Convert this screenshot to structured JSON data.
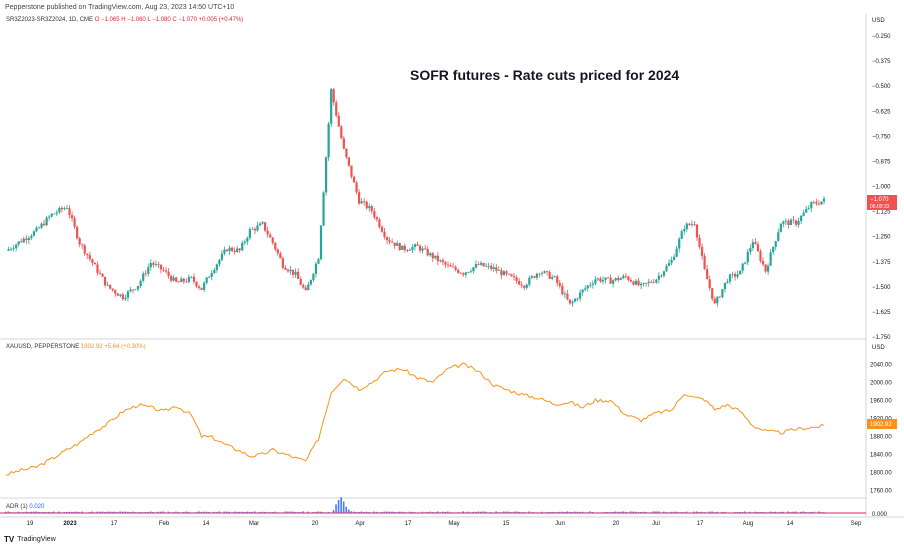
{
  "publisher_line": "Pepperstone published on TradingView.com, Aug 23, 2023 14:50 UTC+10",
  "title": "SOFR futures - Rate cuts priced for 2024",
  "footer_brand": "TradingView",
  "colors": {
    "up": "#26a69a",
    "down": "#ef5350",
    "gold": "#f7931a",
    "adr_up": "#2962ff",
    "adr_down": "#e91e63"
  },
  "panes": {
    "spread": {
      "legend_symbol": "SR3Z2023-SR3Z2024, 1D, CME",
      "legend_values": "O −1.065  H −1.060  L −1.080  C −1.070  +0.005 (+0.47%)",
      "currency": "USD",
      "last_price": "−1.070",
      "countdown": "06:09:33"
    },
    "gold": {
      "legend_symbol": "XAUUSD, PEPPERSTONE",
      "legend_values": "1902.92  +5.64 (+0.30%)",
      "currency": "USD",
      "last_price": "1902.92"
    },
    "adr": {
      "legend_symbol": "ADR (1)",
      "legend_values": "0.020",
      "last_price": "0.000"
    }
  },
  "x_axis_labels": [
    "19",
    "2023",
    "17",
    "Feb",
    "14",
    "Mar",
    "20",
    "Apr",
    "17",
    "May",
    "15",
    "Jun",
    "20",
    "Jul",
    "17",
    "Aug",
    "14",
    "Sep"
  ],
  "chart_data": [
    {
      "type": "candlestick",
      "name": "SR3Z2023-SR3Z2024",
      "y_ticks": [
        "−0.250",
        "−0.375",
        "−0.500",
        "−0.625",
        "−0.750",
        "−0.875",
        "−1.000",
        "−1.125",
        "−1.250",
        "−1.375",
        "−1.500",
        "−1.625",
        "−1.750"
      ],
      "ylim": [
        -1.75,
        -0.25
      ],
      "close_path": [
        [
          0,
          -1.32
        ],
        [
          6,
          -1.27
        ],
        [
          12,
          -1.22
        ],
        [
          18,
          -1.14
        ],
        [
          24,
          -1.1
        ],
        [
          29,
          -1.28
        ],
        [
          34,
          -1.38
        ],
        [
          40,
          -1.5
        ],
        [
          46,
          -1.55
        ],
        [
          52,
          -1.49
        ],
        [
          57,
          -1.38
        ],
        [
          62,
          -1.42
        ],
        [
          67,
          -1.48
        ],
        [
          73,
          -1.46
        ],
        [
          77,
          -1.51
        ],
        [
          81,
          -1.42
        ],
        [
          87,
          -1.31
        ],
        [
          92,
          -1.32
        ],
        [
          96,
          -1.22
        ],
        [
          101,
          -1.19
        ],
        [
          105,
          -1.28
        ],
        [
          109,
          -1.39
        ],
        [
          114,
          -1.44
        ],
        [
          118,
          -1.53
        ],
        [
          123,
          -1.35
        ],
        [
          128,
          -0.52
        ],
        [
          133,
          -0.82
        ],
        [
          139,
          -1.07
        ],
        [
          144,
          -1.12
        ],
        [
          150,
          -1.26
        ],
        [
          156,
          -1.31
        ],
        [
          162,
          -1.3
        ],
        [
          168,
          -1.35
        ],
        [
          174,
          -1.4
        ],
        [
          180,
          -1.43
        ],
        [
          186,
          -1.39
        ],
        [
          192,
          -1.41
        ],
        [
          198,
          -1.45
        ],
        [
          204,
          -1.49
        ],
        [
          210,
          -1.42
        ],
        [
          216,
          -1.46
        ],
        [
          222,
          -1.59
        ],
        [
          227,
          -1.52
        ],
        [
          232,
          -1.46
        ],
        [
          238,
          -1.47
        ],
        [
          244,
          -1.45
        ],
        [
          250,
          -1.5
        ],
        [
          256,
          -1.46
        ],
        [
          262,
          -1.37
        ],
        [
          267,
          -1.2
        ],
        [
          271,
          -1.18
        ],
        [
          275,
          -1.42
        ],
        [
          279,
          -1.59
        ],
        [
          284,
          -1.46
        ],
        [
          289,
          -1.43
        ],
        [
          294,
          -1.27
        ],
        [
          299,
          -1.42
        ],
        [
          305,
          -1.18
        ],
        [
          311,
          -1.18
        ],
        [
          317,
          -1.09
        ],
        [
          322,
          -1.07
        ]
      ],
      "x_domain": [
        0,
        322
      ]
    },
    {
      "type": "line",
      "name": "XAUUSD",
      "y_ticks": [
        "2040.00",
        "2000.00",
        "1960.00",
        "1920.00",
        "1880.00",
        "1840.00",
        "1800.00",
        "1760.00"
      ],
      "ylim": [
        1752,
        2054
      ],
      "values_path": [
        [
          0,
          1795
        ],
        [
          6,
          1805
        ],
        [
          12,
          1812
        ],
        [
          18,
          1830
        ],
        [
          24,
          1850
        ],
        [
          29,
          1866
        ],
        [
          34,
          1888
        ],
        [
          40,
          1908
        ],
        [
          46,
          1935
        ],
        [
          52,
          1950
        ],
        [
          57,
          1944
        ],
        [
          62,
          1935
        ],
        [
          67,
          1948
        ],
        [
          73,
          1927
        ],
        [
          77,
          1880
        ],
        [
          81,
          1878
        ],
        [
          87,
          1860
        ],
        [
          92,
          1848
        ],
        [
          96,
          1836
        ],
        [
          101,
          1840
        ],
        [
          105,
          1850
        ],
        [
          109,
          1842
        ],
        [
          114,
          1832
        ],
        [
          118,
          1825
        ],
        [
          123,
          1875
        ],
        [
          128,
          1978
        ],
        [
          133,
          2010
        ],
        [
          139,
          1985
        ],
        [
          144,
          2000
        ],
        [
          150,
          2025
        ],
        [
          156,
          2030
        ],
        [
          162,
          2010
        ],
        [
          168,
          2000
        ],
        [
          174,
          2030
        ],
        [
          180,
          2040
        ],
        [
          186,
          2024
        ],
        [
          192,
          1994
        ],
        [
          198,
          1982
        ],
        [
          204,
          1972
        ],
        [
          210,
          1964
        ],
        [
          216,
          1952
        ],
        [
          222,
          1956
        ],
        [
          227,
          1944
        ],
        [
          232,
          1960
        ],
        [
          238,
          1960
        ],
        [
          244,
          1928
        ],
        [
          250,
          1916
        ],
        [
          256,
          1932
        ],
        [
          262,
          1938
        ],
        [
          267,
          1976
        ],
        [
          271,
          1966
        ],
        [
          275,
          1962
        ],
        [
          279,
          1940
        ],
        [
          284,
          1950
        ],
        [
          289,
          1936
        ],
        [
          294,
          1904
        ],
        [
          299,
          1892
        ],
        [
          305,
          1888
        ],
        [
          311,
          1896
        ],
        [
          317,
          1900
        ],
        [
          322,
          1903
        ]
      ]
    },
    {
      "type": "histogram",
      "name": "ADR (1)",
      "y_ticks": [
        "0.000"
      ],
      "spike_at": 128,
      "spike_values": [
        0.02,
        0.1,
        0.3,
        0.45,
        0.55,
        0.4,
        0.22,
        0.12,
        0.06
      ]
    }
  ]
}
